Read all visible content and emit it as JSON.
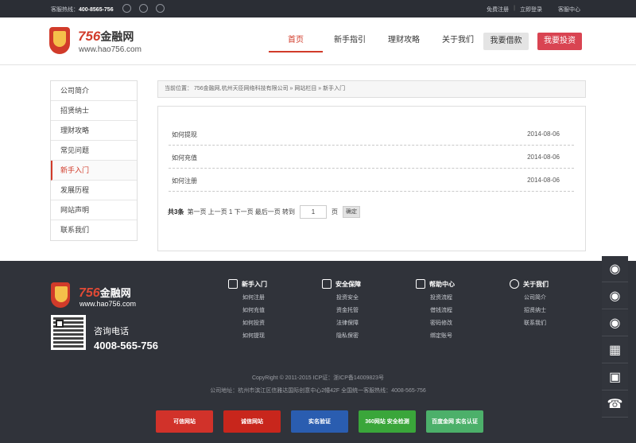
{
  "topbar": {
    "hotline_label": "客服热线：",
    "hotline_number": "400-8565-756",
    "icons": [
      "qq-icon",
      "weibo-icon",
      "wechat-icon"
    ],
    "register": "免费注册",
    "login": "立即登录",
    "service": "客服中心",
    "separator": "|"
  },
  "header": {
    "logo_number": "756",
    "logo_name": "金融网",
    "logo_url": "www.hao756.com",
    "nav": [
      "首页",
      "新手指引",
      "理财攻略",
      "关于我们"
    ],
    "borrow": "我要借款",
    "invest": "我要投资"
  },
  "sidemenu": [
    "公司简介",
    "招贤纳士",
    "理财攻略",
    "常见问题",
    "新手入门",
    "发展历程",
    "网站声明",
    "联系我们"
  ],
  "breadcrumb": "当前位置： 756金融网,杭州天臣网络科技有限公司 » 网站栏目 » 新手入门",
  "articles": [
    {
      "title": "如何提现",
      "date": "2014-08-06"
    },
    {
      "title": "如何充值",
      "date": "2014-08-06"
    },
    {
      "title": "如何注册",
      "date": "2014-08-06"
    }
  ],
  "pager": {
    "total": "共3条",
    "links": "第一页 上一页 1 下一页 最后一页 转到",
    "page_value": "1",
    "page_unit": "页",
    "confirm": "确定"
  },
  "footer": {
    "logo_number": "756",
    "logo_name": "金融网",
    "logo_url": "www.hao756.com",
    "consult_label": "咨询电话",
    "consult_phone": "4008-565-756",
    "columns": [
      {
        "title": "新手入门",
        "icon": "home-icon",
        "links": [
          "如何注册",
          "如何充值",
          "如何投资",
          "如何提现"
        ]
      },
      {
        "title": "安全保障",
        "icon": "thumbs-up-icon",
        "links": [
          "投资安全",
          "资金托管",
          "法律保障",
          "隐私保密"
        ]
      },
      {
        "title": "帮助中心",
        "icon": "help-center-icon",
        "links": [
          "投资流程",
          "借钱流程",
          "密码修改",
          "绑定账号"
        ]
      },
      {
        "title": "关于我们",
        "icon": "user-icon",
        "links": [
          "公司简介",
          "招贤纳士",
          "联系我们"
        ]
      }
    ],
    "copyright": "CopyRight © 2011-2015 ICP证：浙ICP备14009823号",
    "address": "公司地址：杭州市滨江区信雅达国际创意中心2幢42F 全国统一客服热线：4008-565-756",
    "badges": [
      {
        "label": "可信网站",
        "color": "#d1322a"
      },
      {
        "label": "诚信网站",
        "color": "#c8261c"
      },
      {
        "label": "实名验证",
        "color": "#2a5db0"
      },
      {
        "label": "360网站 安全检测",
        "color": "#3aa63a"
      },
      {
        "label": "百度金网 实名认证",
        "color": "#4cb06a"
      }
    ]
  },
  "tools": [
    "qq-icon",
    "qq-icon",
    "qq-icon",
    "calculator-icon",
    "qr-code-icon",
    "phone-icon"
  ],
  "colors": {
    "accent": "#d13b2a",
    "invest": "#d94452",
    "dark": "#30333a"
  }
}
